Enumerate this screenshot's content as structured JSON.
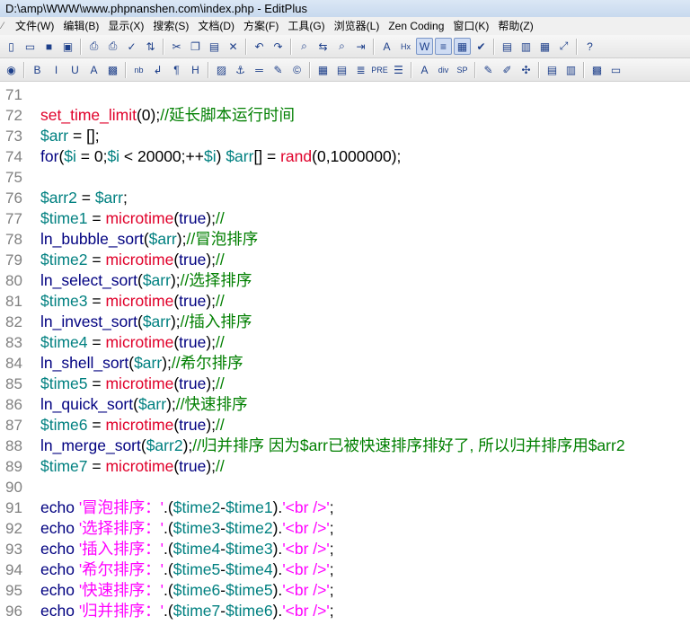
{
  "window": {
    "title": "D:\\amp\\WWW\\www.phpnanshen.com\\index.php - EditPlus"
  },
  "menu": [
    "文件(W)",
    "编辑(B)",
    "显示(X)",
    "搜索(S)",
    "文档(D)",
    "方案(F)",
    "工具(G)",
    "浏览器(L)",
    "Zen Coding",
    "窗口(K)",
    "帮助(Z)"
  ],
  "toolbar1": [
    {
      "name": "new-file-icon",
      "glyph": "▯"
    },
    {
      "name": "open-folder-icon",
      "glyph": "▭"
    },
    {
      "name": "save-icon",
      "glyph": "■"
    },
    {
      "name": "save-all-icon",
      "glyph": "▣"
    },
    {
      "sep": true
    },
    {
      "name": "print-preview-icon",
      "glyph": "⎙"
    },
    {
      "name": "print-icon",
      "glyph": "⎙"
    },
    {
      "name": "spellcheck-icon",
      "glyph": "✓"
    },
    {
      "name": "ftp-icon",
      "glyph": "⇅"
    },
    {
      "sep": true
    },
    {
      "name": "cut-icon",
      "glyph": "✂"
    },
    {
      "name": "copy-icon",
      "glyph": "❐"
    },
    {
      "name": "paste-icon",
      "glyph": "▤"
    },
    {
      "name": "delete-icon",
      "glyph": "✕"
    },
    {
      "sep": true
    },
    {
      "name": "undo-icon",
      "glyph": "↶"
    },
    {
      "name": "redo-icon",
      "glyph": "↷"
    },
    {
      "sep": true
    },
    {
      "name": "find-icon",
      "glyph": "⌕"
    },
    {
      "name": "replace-icon",
      "glyph": "⇆"
    },
    {
      "name": "find-in-files-icon",
      "glyph": "⌕"
    },
    {
      "name": "goto-line-icon",
      "glyph": "⇥"
    },
    {
      "sep": true
    },
    {
      "name": "font-icon",
      "glyph": "A"
    },
    {
      "name": "hex-icon",
      "glyph": "Hx"
    },
    {
      "name": "word-wrap-icon",
      "glyph": "W",
      "pressed": true
    },
    {
      "name": "ruler-icon",
      "glyph": "≡",
      "pressed": true
    },
    {
      "name": "column-select-icon",
      "glyph": "▦",
      "pressed": true
    },
    {
      "name": "check-icon",
      "glyph": "✔"
    },
    {
      "sep": true
    },
    {
      "name": "directory-window-icon",
      "glyph": "▤"
    },
    {
      "name": "cliptext-window-icon",
      "glyph": "▥"
    },
    {
      "name": "output-window-icon",
      "glyph": "▦"
    },
    {
      "name": "fullscreen-icon",
      "glyph": "⤢"
    },
    {
      "sep": true
    },
    {
      "name": "help-pointer-icon",
      "glyph": "?"
    }
  ],
  "toolbar2": [
    {
      "name": "browser-icon",
      "glyph": "◉"
    },
    {
      "sep": true
    },
    {
      "name": "bold-icon",
      "glyph": "B"
    },
    {
      "name": "italic-icon",
      "glyph": "I"
    },
    {
      "name": "underline-icon",
      "glyph": "U"
    },
    {
      "name": "font-color-icon",
      "glyph": "A"
    },
    {
      "name": "color-palette-icon",
      "glyph": "▩"
    },
    {
      "sep": true
    },
    {
      "name": "nbsp-icon",
      "glyph": "nb"
    },
    {
      "name": "line-break-icon",
      "glyph": "↲"
    },
    {
      "name": "paragraph-icon",
      "glyph": "¶"
    },
    {
      "name": "heading-icon",
      "glyph": "H"
    },
    {
      "sep": true
    },
    {
      "name": "image-icon",
      "glyph": "▨"
    },
    {
      "name": "anchor-icon",
      "glyph": "⚓"
    },
    {
      "name": "horizontal-rule-icon",
      "glyph": "═"
    },
    {
      "name": "edit-pen-icon",
      "glyph": "✎"
    },
    {
      "name": "comment-icon",
      "glyph": "©"
    },
    {
      "sep": true
    },
    {
      "name": "table-icon",
      "glyph": "▦"
    },
    {
      "name": "form-icon",
      "glyph": "▤"
    },
    {
      "name": "center-icon",
      "glyph": "≣"
    },
    {
      "name": "pre-icon",
      "glyph": "PRE"
    },
    {
      "name": "list-icon",
      "glyph": "☰"
    },
    {
      "sep": true
    },
    {
      "name": "text-icon",
      "glyph": "A"
    },
    {
      "name": "div-icon",
      "glyph": "div"
    },
    {
      "name": "span-icon",
      "glyph": "SP"
    },
    {
      "sep": true
    },
    {
      "name": "css-edit-icon",
      "glyph": "✎"
    },
    {
      "name": "style-icon",
      "glyph": "✐"
    },
    {
      "name": "script-icon",
      "glyph": "✣"
    },
    {
      "sep": true
    },
    {
      "name": "html-toolbar-icon",
      "glyph": "▤"
    },
    {
      "name": "ie-toolbar-icon",
      "glyph": "▥"
    },
    {
      "sep": true
    },
    {
      "name": "color-picker-icon",
      "glyph": "▩"
    },
    {
      "name": "window-icon",
      "glyph": "▭"
    }
  ],
  "code_lines": [
    {
      "n": "71",
      "t": []
    },
    {
      "n": "72",
      "t": [
        [
          "fn",
          "set_time_limit"
        ],
        [
          "op",
          "(0);"
        ],
        [
          "cm",
          "//延长脚本运行时间"
        ]
      ]
    },
    {
      "n": "73",
      "t": [
        [
          "var",
          "$arr"
        ],
        [
          "op",
          " = [];"
        ]
      ]
    },
    {
      "n": "74",
      "t": [
        [
          "kw",
          "for"
        ],
        [
          "op",
          "("
        ],
        [
          "var",
          "$i"
        ],
        [
          "op",
          " = 0;"
        ],
        [
          "var",
          "$i"
        ],
        [
          "op",
          " < 20000;++"
        ],
        [
          "var",
          "$i"
        ],
        [
          "op",
          ") "
        ],
        [
          "var",
          "$arr"
        ],
        [
          "op",
          "[] = "
        ],
        [
          "fn",
          "rand"
        ],
        [
          "op",
          "(0,1000000);"
        ]
      ]
    },
    {
      "n": "75",
      "t": []
    },
    {
      "n": "76",
      "t": [
        [
          "var",
          "$arr2"
        ],
        [
          "op",
          " = "
        ],
        [
          "var",
          "$arr"
        ],
        [
          "op",
          ";"
        ]
      ]
    },
    {
      "n": "77",
      "t": [
        [
          "var",
          "$time1"
        ],
        [
          "op",
          " = "
        ],
        [
          "fn",
          "microtime"
        ],
        [
          "op",
          "("
        ],
        [
          "kw",
          "true"
        ],
        [
          "op",
          ");"
        ],
        [
          "cm",
          "//"
        ]
      ]
    },
    {
      "n": "78",
      "t": [
        [
          "kw",
          "ln_bubble_sort"
        ],
        [
          "op",
          "("
        ],
        [
          "var",
          "$arr"
        ],
        [
          "op",
          ");"
        ],
        [
          "cm",
          "//冒泡排序"
        ]
      ]
    },
    {
      "n": "79",
      "t": [
        [
          "var",
          "$time2"
        ],
        [
          "op",
          " = "
        ],
        [
          "fn",
          "microtime"
        ],
        [
          "op",
          "("
        ],
        [
          "kw",
          "true"
        ],
        [
          "op",
          ");"
        ],
        [
          "cm",
          "//"
        ]
      ]
    },
    {
      "n": "80",
      "t": [
        [
          "kw",
          "ln_select_sort"
        ],
        [
          "op",
          "("
        ],
        [
          "var",
          "$arr"
        ],
        [
          "op",
          ");"
        ],
        [
          "cm",
          "//选择排序"
        ]
      ]
    },
    {
      "n": "81",
      "t": [
        [
          "var",
          "$time3"
        ],
        [
          "op",
          " = "
        ],
        [
          "fn",
          "microtime"
        ],
        [
          "op",
          "("
        ],
        [
          "kw",
          "true"
        ],
        [
          "op",
          ");"
        ],
        [
          "cm",
          "//"
        ]
      ]
    },
    {
      "n": "82",
      "t": [
        [
          "kw",
          "ln_invest_sort"
        ],
        [
          "op",
          "("
        ],
        [
          "var",
          "$arr"
        ],
        [
          "op",
          ");"
        ],
        [
          "cm",
          "//插入排序"
        ]
      ]
    },
    {
      "n": "83",
      "t": [
        [
          "var",
          "$time4"
        ],
        [
          "op",
          " = "
        ],
        [
          "fn",
          "microtime"
        ],
        [
          "op",
          "("
        ],
        [
          "kw",
          "true"
        ],
        [
          "op",
          ");"
        ],
        [
          "cm",
          "//"
        ]
      ]
    },
    {
      "n": "84",
      "t": [
        [
          "kw",
          "ln_shell_sort"
        ],
        [
          "op",
          "("
        ],
        [
          "var",
          "$arr"
        ],
        [
          "op",
          ");"
        ],
        [
          "cm",
          "//希尔排序"
        ]
      ]
    },
    {
      "n": "85",
      "t": [
        [
          "var",
          "$time5"
        ],
        [
          "op",
          " = "
        ],
        [
          "fn",
          "microtime"
        ],
        [
          "op",
          "("
        ],
        [
          "kw",
          "true"
        ],
        [
          "op",
          ");"
        ],
        [
          "cm",
          "//"
        ]
      ]
    },
    {
      "n": "86",
      "t": [
        [
          "kw",
          "ln_quick_sort"
        ],
        [
          "op",
          "("
        ],
        [
          "var",
          "$arr"
        ],
        [
          "op",
          ");"
        ],
        [
          "cm",
          "//快速排序"
        ]
      ]
    },
    {
      "n": "87",
      "t": [
        [
          "var",
          "$time6"
        ],
        [
          "op",
          " = "
        ],
        [
          "fn",
          "microtime"
        ],
        [
          "op",
          "("
        ],
        [
          "kw",
          "true"
        ],
        [
          "op",
          ");"
        ],
        [
          "cm",
          "//"
        ]
      ]
    },
    {
      "n": "88",
      "t": [
        [
          "kw",
          "ln_merge_sort"
        ],
        [
          "op",
          "("
        ],
        [
          "var",
          "$arr2"
        ],
        [
          "op",
          ");"
        ],
        [
          "cm",
          "//归并排序 因为$arr已被快速排序排好了, 所以归并排序用$arr2"
        ]
      ]
    },
    {
      "n": "89",
      "t": [
        [
          "var",
          "$time7"
        ],
        [
          "op",
          " = "
        ],
        [
          "fn",
          "microtime"
        ],
        [
          "op",
          "("
        ],
        [
          "kw",
          "true"
        ],
        [
          "op",
          ");"
        ],
        [
          "cm",
          "//"
        ]
      ]
    },
    {
      "n": "90",
      "t": []
    },
    {
      "n": "91",
      "t": [
        [
          "kw",
          "echo"
        ],
        [
          "op",
          " "
        ],
        [
          "str",
          "'冒泡排序：'"
        ],
        [
          "op",
          ".("
        ],
        [
          "var",
          "$time2"
        ],
        [
          "op",
          "-"
        ],
        [
          "var",
          "$time1"
        ],
        [
          "op",
          ")."
        ],
        [
          "str",
          "'<br />'"
        ],
        [
          "op",
          ";"
        ]
      ]
    },
    {
      "n": "92",
      "t": [
        [
          "kw",
          "echo"
        ],
        [
          "op",
          " "
        ],
        [
          "str",
          "'选择排序：'"
        ],
        [
          "op",
          ".("
        ],
        [
          "var",
          "$time3"
        ],
        [
          "op",
          "-"
        ],
        [
          "var",
          "$time2"
        ],
        [
          "op",
          ")."
        ],
        [
          "str",
          "'<br />'"
        ],
        [
          "op",
          ";"
        ]
      ]
    },
    {
      "n": "93",
      "t": [
        [
          "kw",
          "echo"
        ],
        [
          "op",
          " "
        ],
        [
          "str",
          "'插入排序：'"
        ],
        [
          "op",
          ".("
        ],
        [
          "var",
          "$time4"
        ],
        [
          "op",
          "-"
        ],
        [
          "var",
          "$time3"
        ],
        [
          "op",
          ")."
        ],
        [
          "str",
          "'<br />'"
        ],
        [
          "op",
          ";"
        ]
      ]
    },
    {
      "n": "94",
      "t": [
        [
          "kw",
          "echo"
        ],
        [
          "op",
          " "
        ],
        [
          "str",
          "'希尔排序：'"
        ],
        [
          "op",
          ".("
        ],
        [
          "var",
          "$time5"
        ],
        [
          "op",
          "-"
        ],
        [
          "var",
          "$time4"
        ],
        [
          "op",
          ")."
        ],
        [
          "str",
          "'<br />'"
        ],
        [
          "op",
          ";"
        ]
      ]
    },
    {
      "n": "95",
      "t": [
        [
          "kw",
          "echo"
        ],
        [
          "op",
          " "
        ],
        [
          "str",
          "'快速排序：'"
        ],
        [
          "op",
          ".("
        ],
        [
          "var",
          "$time6"
        ],
        [
          "op",
          "-"
        ],
        [
          "var",
          "$time5"
        ],
        [
          "op",
          ")."
        ],
        [
          "str",
          "'<br />'"
        ],
        [
          "op",
          ";"
        ]
      ]
    },
    {
      "n": "96",
      "t": [
        [
          "kw",
          "echo"
        ],
        [
          "op",
          " "
        ],
        [
          "str",
          "'归并排序：'"
        ],
        [
          "op",
          ".("
        ],
        [
          "var",
          "$time7"
        ],
        [
          "op",
          "-"
        ],
        [
          "var",
          "$time6"
        ],
        [
          "op",
          ")."
        ],
        [
          "str",
          "'<br />'"
        ],
        [
          "op",
          ";"
        ]
      ]
    }
  ]
}
